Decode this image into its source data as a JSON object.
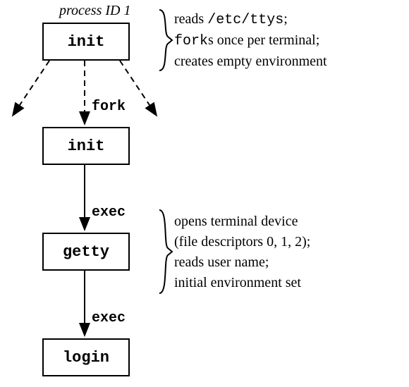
{
  "header": {
    "title": "process ID 1"
  },
  "boxes": {
    "init_top": "init",
    "init_mid": "init",
    "getty": "getty",
    "login": "login"
  },
  "arrows": {
    "fork": "fork",
    "exec_top": "exec",
    "exec_bottom": "exec"
  },
  "annotations": {
    "top": {
      "line1_a": "reads ",
      "line1_b": "/etc/ttys",
      "line1_c": ";",
      "line2_a": "fork",
      "line2_b": "s once per terminal;",
      "line3": "creates empty environment"
    },
    "getty": {
      "line1": "opens terminal device",
      "line2": "(file descriptors 0, 1, 2);",
      "line3": "reads user name;",
      "line4": "initial environment set"
    }
  }
}
